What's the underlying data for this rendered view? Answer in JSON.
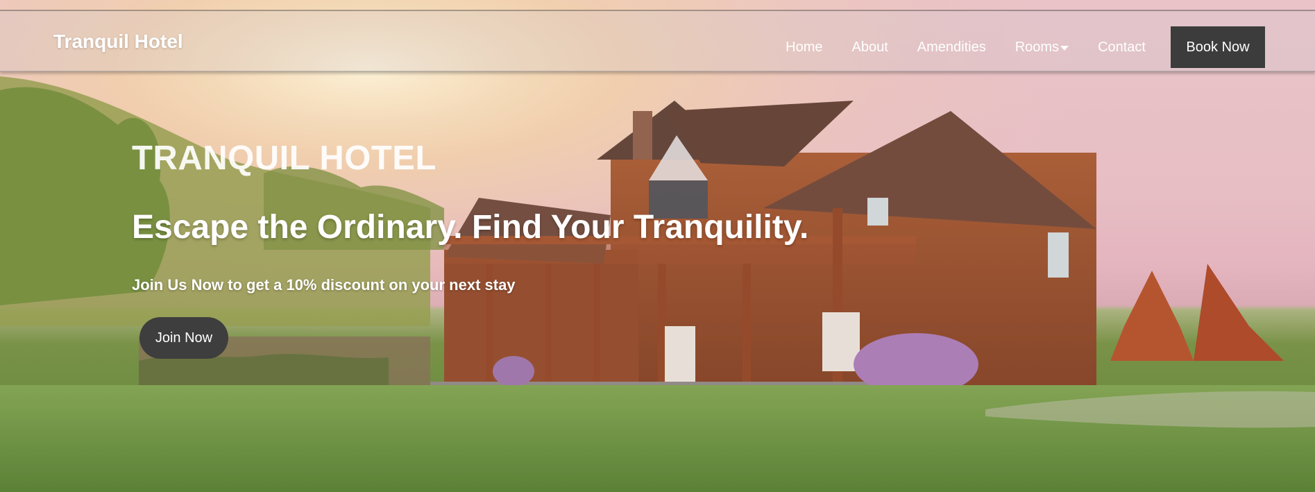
{
  "header": {
    "brand": "Tranquil Hotel",
    "nav": [
      {
        "label": "Home"
      },
      {
        "label": "About"
      },
      {
        "label": "Amendities"
      },
      {
        "label": "Rooms"
      },
      {
        "label": "Contact"
      }
    ],
    "cta_label": "Book Now"
  },
  "hero": {
    "title": "TRANQUIL HOTEL",
    "tagline": "Escape the Ordinary. Find Your Tranquility.",
    "subtitle": "Join Us Now to get a 10% discount on your next stay",
    "button_label": "Join Now",
    "image_description_icon": "log-house-photo"
  },
  "colors": {
    "button_dark": "#3c3c3c",
    "text": "#ffffff"
  }
}
